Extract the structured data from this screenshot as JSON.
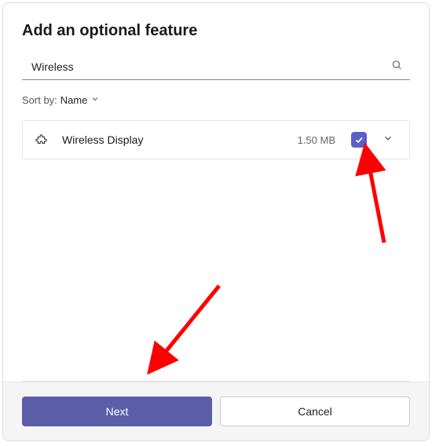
{
  "dialog": {
    "title": "Add an optional feature"
  },
  "search": {
    "value": "Wireless",
    "placeholder": ""
  },
  "sort": {
    "label": "Sort by:",
    "value": "Name"
  },
  "feature": {
    "name": "Wireless Display",
    "size": "1.50 MB",
    "selected": true
  },
  "footer": {
    "next": "Next",
    "cancel": "Cancel"
  },
  "ui_accent_color": "#5b5fc7"
}
